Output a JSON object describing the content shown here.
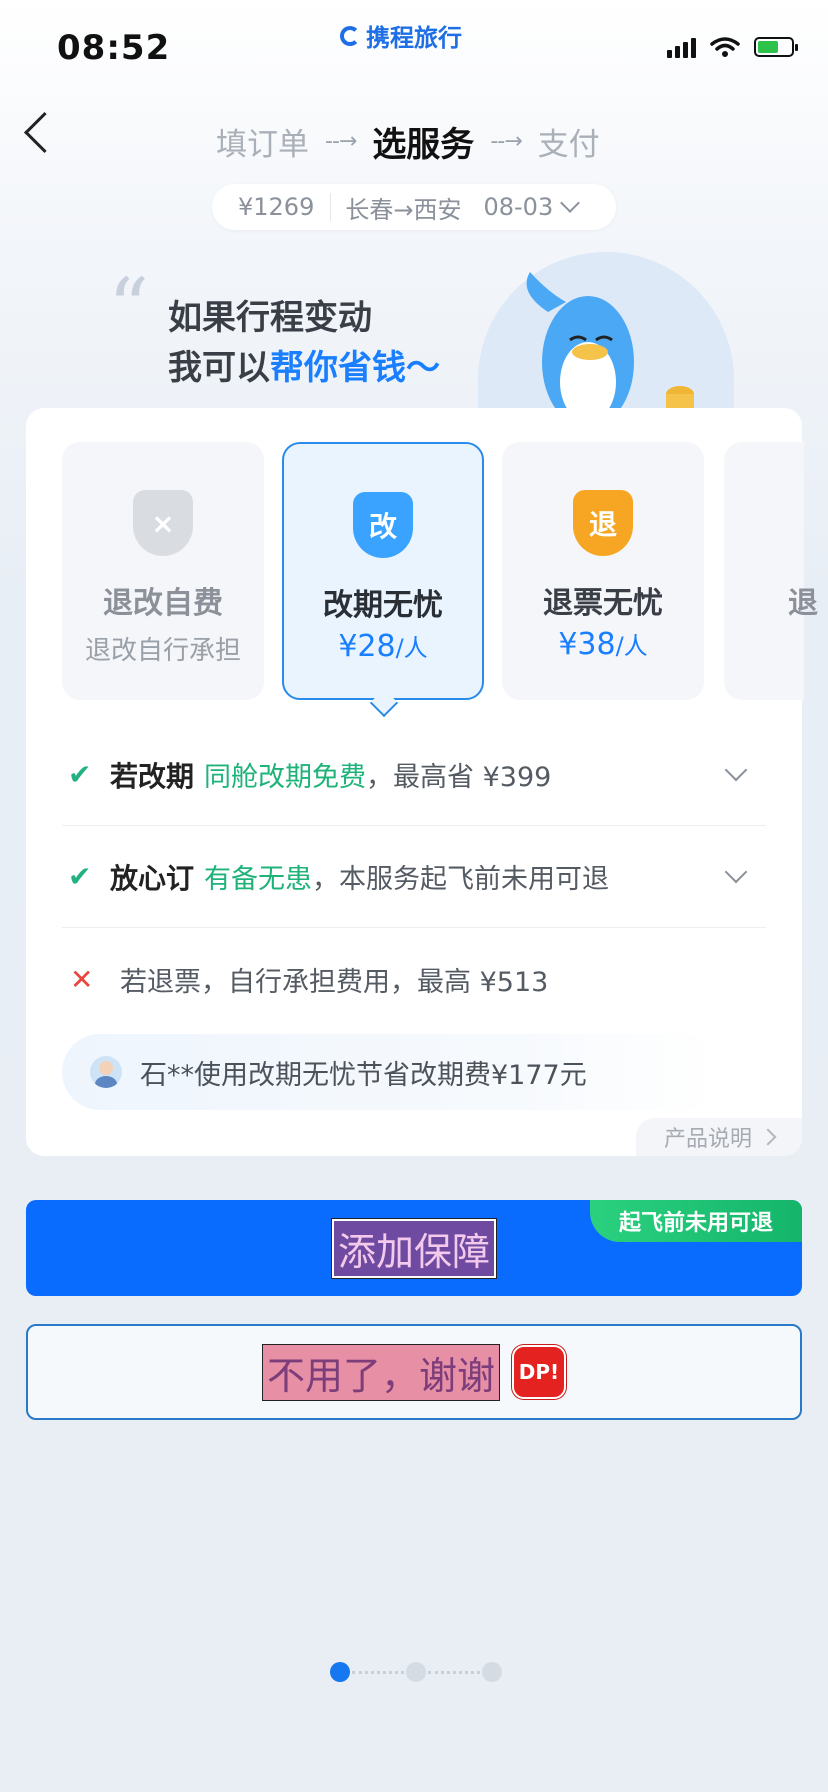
{
  "status_bar": {
    "time": "08:52",
    "brand": "携程旅行"
  },
  "nav": {
    "steps": [
      "填订单",
      "选服务",
      "支付"
    ],
    "active_step": 1,
    "arrow": "--→"
  },
  "trip": {
    "price": "¥1269",
    "route": "长春→西安",
    "date": "08-03"
  },
  "hero": {
    "line1": "如果行程变动",
    "line2_prefix": "我可以",
    "line2_highlight": "帮你省钱～"
  },
  "plans": [
    {
      "icon": "×",
      "title": "退改自费",
      "sub": "退改自行承担"
    },
    {
      "icon": "改",
      "title": "改期无忧",
      "price": "¥28",
      "unit": "/人",
      "selected": true
    },
    {
      "icon": "退",
      "title": "退票无忧",
      "price": "¥38",
      "unit": "/人"
    },
    {
      "title": "退"
    }
  ],
  "benefits": [
    {
      "status": "ok",
      "bold": "若改期",
      "highlight": "同舱改期免费",
      "rest": "，最高省 ¥399",
      "expandable": true
    },
    {
      "status": "ok",
      "bold": "放心订",
      "highlight": "有备无患",
      "rest": "，本服务起飞前未用可退",
      "expandable": true
    },
    {
      "status": "no",
      "text": "若退票，自行承担费用，最高 ¥513"
    }
  ],
  "testimonial": "石**使用改期无忧节省改期费¥177元",
  "product_info": "产品说明",
  "buttons": {
    "add": "添加保障",
    "add_badge": "起飞前未用可退",
    "decline": "不用了，谢谢",
    "decline_badge": "DP!"
  },
  "pager": {
    "count": 3,
    "active": 0
  },
  "colors": {
    "primary": "#0a6cff",
    "green": "#1fb37a",
    "red": "#e8463b",
    "orange": "#f7a623"
  }
}
